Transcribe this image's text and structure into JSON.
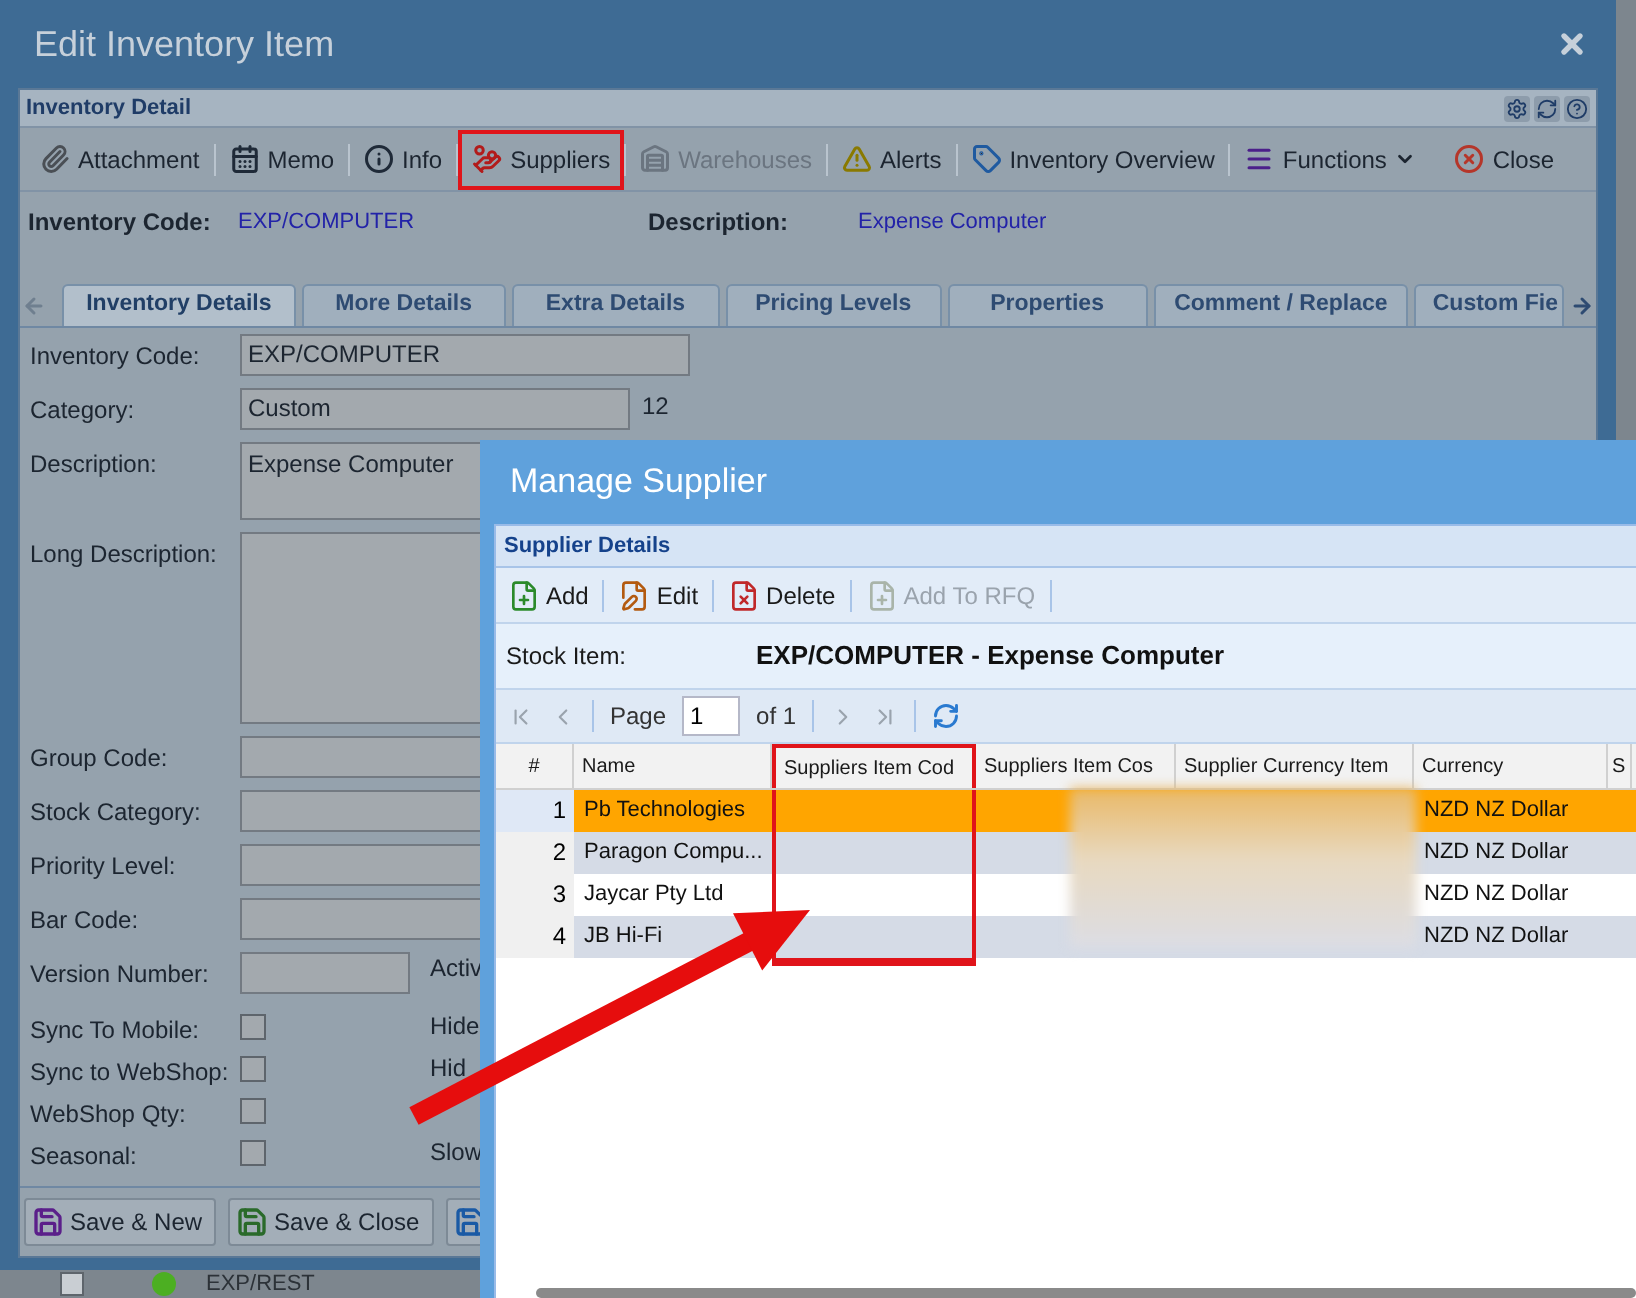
{
  "window": {
    "title": "Edit Inventory Item"
  },
  "panel": {
    "title": "Inventory Detail"
  },
  "toolbar": [
    {
      "label": "Attachment",
      "disabled": false,
      "highlighted": false
    },
    {
      "label": "Memo",
      "disabled": false,
      "highlighted": false
    },
    {
      "label": "Info",
      "disabled": false,
      "highlighted": false
    },
    {
      "label": "Suppliers",
      "disabled": false,
      "highlighted": true
    },
    {
      "label": "Warehouses",
      "disabled": true,
      "highlighted": false
    },
    {
      "label": "Alerts",
      "disabled": false,
      "highlighted": false
    },
    {
      "label": "Inventory Overview",
      "disabled": false,
      "highlighted": false
    },
    {
      "label": "Functions",
      "disabled": false,
      "highlighted": false
    },
    {
      "label": "Close",
      "disabled": false,
      "highlighted": false
    }
  ],
  "summary": [
    {
      "label": "Inventory Code:",
      "value": "EXP/COMPUTER"
    },
    {
      "label": "Description:",
      "value": "Expense Computer"
    }
  ],
  "tabs": [
    {
      "label": "Inventory Details",
      "selected": true
    },
    {
      "label": "More Details",
      "selected": false
    },
    {
      "label": "Extra Details",
      "selected": false
    },
    {
      "label": "Pricing Levels",
      "selected": false
    },
    {
      "label": "Properties",
      "selected": false
    },
    {
      "label": "Comment / Replace",
      "selected": false
    },
    {
      "label": "Custom Fie",
      "selected": false
    }
  ],
  "form": [
    {
      "kind": "wide",
      "label": "Inventory Code:",
      "value": "EXP/COMPUTER"
    },
    {
      "kind": "medium",
      "label": "Category:",
      "value": "Custom",
      "side": "12"
    },
    {
      "kind": "memo",
      "label": "Description:",
      "value": "Expense Computer"
    },
    {
      "kind": "long",
      "label": "Long Description:"
    },
    {
      "kind": "wide",
      "label": "Group Code:"
    },
    {
      "kind": "wide",
      "label": "Stock Category:"
    },
    {
      "kind": "wide",
      "label": "Priority Level:"
    },
    {
      "kind": "wide",
      "label": "Bar Code:"
    },
    {
      "kind": "short",
      "label": "Version Number:",
      "side": "Activ"
    },
    {
      "kind": "checkbox",
      "label": "Sync To Mobile:",
      "checked": false,
      "side": "Hide"
    },
    {
      "kind": "checkbox",
      "label": "Sync to WebShop:",
      "checked": false,
      "side": "Hid"
    },
    {
      "kind": "checkbox",
      "label": "WebShop Qty:",
      "checked": false
    },
    {
      "kind": "checkbox",
      "label": "Seasonal:",
      "checked": false,
      "side": "Slow"
    }
  ],
  "footer_buttons": [
    {
      "kind": "new",
      "label": "Save & New"
    },
    {
      "kind": "close",
      "label": "Save & Close"
    },
    {
      "kind": "save"
    }
  ],
  "background_row": {
    "checked": false,
    "color": "#4caf22",
    "code": "EXP/REST"
  },
  "dialog": {
    "title": "Manage Supplier",
    "panel_title": "Supplier Details",
    "toolbar": [
      {
        "label": "Add",
        "disabled": false
      },
      {
        "label": "Edit",
        "disabled": false
      },
      {
        "label": "Delete",
        "disabled": false
      },
      {
        "label": "Add To RFQ",
        "disabled": true
      }
    ],
    "stock_item_label": "Stock Item:",
    "stock_item": "EXP/COMPUTER - Expense Computer",
    "pager": {
      "page_label": "Page",
      "page": "1",
      "of": "of 1"
    },
    "columns": [
      {
        "label": "#",
        "highlighted": false
      },
      {
        "label": "Name",
        "highlighted": false
      },
      {
        "label": "Suppliers Item Cod",
        "highlighted": true
      },
      {
        "label": "Suppliers Item Cos",
        "highlighted": false
      },
      {
        "label": "Supplier Currency Item",
        "highlighted": false
      },
      {
        "label": "Currency",
        "highlighted": false
      },
      {
        "label": "S",
        "highlighted": false
      }
    ],
    "rows": [
      {
        "number": "1",
        "name": "Pb Technologies",
        "currency": "NZD NZ Dollar",
        "selected": true
      },
      {
        "number": "2",
        "name": "Paragon Compu...",
        "currency": "NZD NZ Dollar",
        "selected": false
      },
      {
        "number": "3",
        "name": "Jaycar Pty Ltd",
        "currency": "NZD NZ Dollar",
        "selected": false
      },
      {
        "number": "4",
        "name": "JB Hi-Fi",
        "currency": "NZD NZ Dollar",
        "selected": false
      }
    ]
  }
}
